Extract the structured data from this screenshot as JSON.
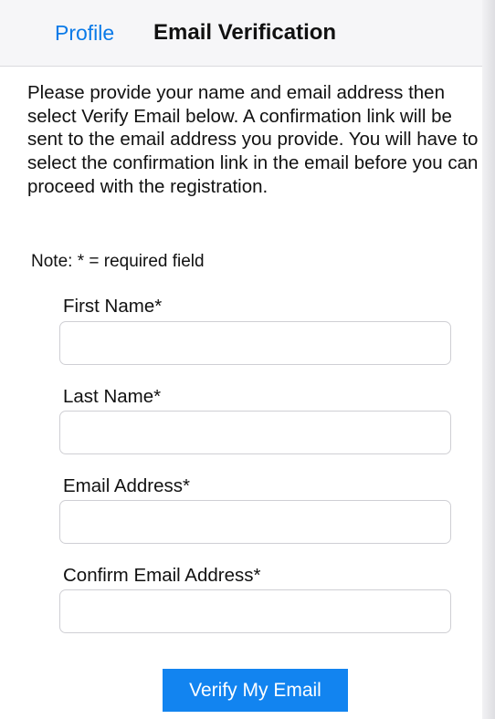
{
  "navbar": {
    "back_label": "Profile",
    "title": "Email Verification"
  },
  "intro": {
    "text": "Please provide your name and email address then select Verify Email below. A confirmation link will be sent to the email address you provide. You will have to select the confirmation link in the email before you can proceed with the registration."
  },
  "note": {
    "text": "Note: * = required field"
  },
  "form": {
    "first_name": {
      "label": "First Name*",
      "value": "",
      "placeholder": ""
    },
    "last_name": {
      "label": "Last Name*",
      "value": "",
      "placeholder": ""
    },
    "email": {
      "label": "Email Address*",
      "value": "",
      "placeholder": ""
    },
    "confirm_email": {
      "label": "Confirm Email Address*",
      "value": "",
      "placeholder": ""
    },
    "submit_label": "Verify My Email"
  },
  "colors": {
    "accent": "#1284f0",
    "link": "#0a7ae8"
  }
}
